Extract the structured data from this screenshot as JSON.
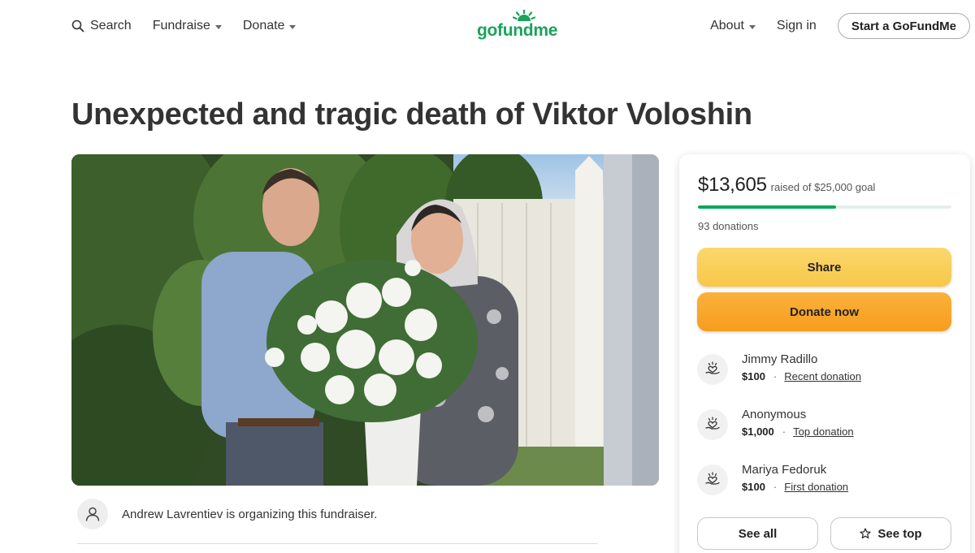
{
  "header": {
    "search_label": "Search",
    "fundraise_label": "Fundraise",
    "donate_label": "Donate",
    "logo_text": "gofundme",
    "about_label": "About",
    "signin_label": "Sign in",
    "start_label": "Start a GoFundMe"
  },
  "campaign": {
    "title": "Unexpected and tragic death of Viktor Voloshin",
    "organizer_text": "Andrew Lavrentiev is organizing this fundraiser."
  },
  "donation_card": {
    "raised_amount": "$13,605",
    "raised_goal_text": "raised of $25,000 goal",
    "progress_fraction": 0.5442,
    "donation_count": "93 donations",
    "share_label": "Share",
    "donate_label": "Donate now",
    "donors": [
      {
        "name": "Jimmy Radillo",
        "amount": "$100",
        "tag": "Recent donation"
      },
      {
        "name": "Anonymous",
        "amount": "$1,000",
        "tag": "Top donation"
      },
      {
        "name": "Mariya Fedoruk",
        "amount": "$100",
        "tag": "First donation"
      }
    ],
    "see_all_label": "See all",
    "see_top_label": "See top"
  },
  "colors": {
    "brand_green": "#02a95c",
    "share_yellow": "#f9d05b",
    "donate_orange": "#f8a62a"
  },
  "icons": {
    "search": "search-icon",
    "caret": "chevron-down-icon",
    "organizer": "user-icon",
    "donor": "heart-hand-icon",
    "see_top": "star-icon"
  }
}
